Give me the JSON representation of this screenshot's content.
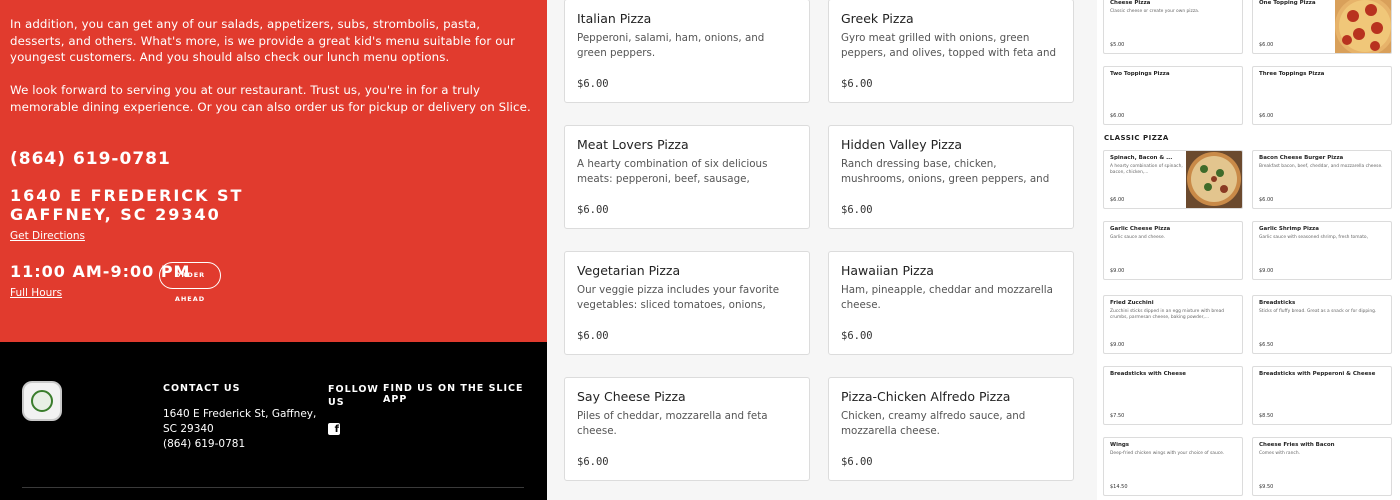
{
  "intro": {
    "paragraph1": "In addition, you can get any of our salads, appetizers, subs, strombolis, pasta, desserts, and others. What's more, is we provide a great kid's menu suitable for our youngest customers. And you should also check our lunch menu options.",
    "paragraph2": "We look forward to serving you at our restaurant. Trust us, you're in for a truly memorable dining experience. Or you can also order us for pickup or delivery on Slice."
  },
  "contact": {
    "phone": "(864) 619-0781",
    "address_line1": "1640 E FREDERICK ST",
    "address_line2": "GAFFNEY, SC 29340",
    "directions_label": "Get Directions",
    "hours": "11:00 AM-9:00 PM",
    "order_ahead_label": "ORDER AHEAD",
    "full_hours_label": "Full Hours"
  },
  "footer": {
    "contact_heading": "CONTACT US",
    "contact_address": "1640 E Frederick St, Gaffney, SC 29340",
    "contact_phone": "(864) 619-0781",
    "follow_heading": "FOLLOW US",
    "slice_heading": "FIND US ON THE SLICE APP",
    "social_icon": "facebook-icon"
  },
  "menu_items": [
    {
      "name": "Italian Pizza",
      "desc": "Pepperoni, salami, ham, onions, and green peppers.",
      "price": "$6.00"
    },
    {
      "name": "Greek Pizza",
      "desc": "Gyro meat grilled with onions, green peppers, and olives, topped with feta and mozzarella cheese.",
      "price": "$6.00"
    },
    {
      "name": "Meat Lovers Pizza",
      "desc": "A hearty combination of six delicious meats: pepperoni, beef, sausage, Canadian bacon, ham...",
      "price": "$6.00"
    },
    {
      "name": "Hidden Valley Pizza",
      "desc": "Ranch dressing base, chicken, mushrooms, onions, green peppers, and tomatoes topped wit...",
      "price": "$6.00"
    },
    {
      "name": "Vegetarian Pizza",
      "desc": "Our veggie pizza includes your favorite vegetables: sliced tomatoes, onions, green peppers,...",
      "price": "$6.00"
    },
    {
      "name": "Hawaiian Pizza",
      "desc": "Ham, pineapple, cheddar and mozzarella cheese.",
      "price": "$6.00"
    },
    {
      "name": "Say Cheese Pizza",
      "desc": "Piles of cheddar, mozzarella and feta cheese.",
      "price": "$6.00"
    },
    {
      "name": "Pizza-Chicken Alfredo Pizza",
      "desc": "Chicken, creamy alfredo sauce, and mozzarella cheese.",
      "price": "$6.00"
    }
  ],
  "classic_heading": "CLASSIC PIZZA",
  "small_items": [
    {
      "name": "Cheese Pizza",
      "desc": "Classic cheese or create your own pizza.",
      "price": "$5.00"
    },
    {
      "name": "One Topping Pizza",
      "desc": "",
      "price": "$6.00"
    },
    {
      "name": "Two Toppings Pizza",
      "desc": "",
      "price": "$6.00"
    },
    {
      "name": "Three Toppings Pizza",
      "desc": "",
      "price": "$6.00"
    },
    {
      "name": "Spinach, Bacon & ...",
      "desc": "A hearty combination of spinach, bacon, chicken,...",
      "price": "$6.00"
    },
    {
      "name": "Bacon Cheese Burger Pizza",
      "desc": "Breakfast bacon, beef, cheddar, and mozzarella cheese.",
      "price": "$6.00"
    },
    {
      "name": "Garlic Cheese Pizza",
      "desc": "Garlic sauce and cheese.",
      "price": "$9.00"
    },
    {
      "name": "Garlic Shrimp Pizza",
      "desc": "Garlic sauce with seasoned shrimp, fresh tomato,",
      "price": "$9.00"
    },
    {
      "name": "Fried Zucchini",
      "desc": "Zucchini sticks dipped in an egg mixture with bread crumbs, parmesan cheese, baking powder,...",
      "price": "$9.00"
    },
    {
      "name": "Breadsticks",
      "desc": "Sticks of fluffy bread. Great as a snack or for dipping.",
      "price": "$6.50"
    },
    {
      "name": "Breadsticks with Cheese",
      "desc": "",
      "price": "$7.50"
    },
    {
      "name": "Breadsticks with Pepperoni & Cheese",
      "desc": "",
      "price": "$8.50"
    },
    {
      "name": "Wings",
      "desc": "Deep-fried chicken wings with your choice of sauce.",
      "price": "$14.50"
    },
    {
      "name": "Cheese Fries with Bacon",
      "desc": "Comes with ranch.",
      "price": "$9.50"
    }
  ],
  "colors": {
    "brand_red": "#e13b2e",
    "footer_black": "#000000"
  }
}
